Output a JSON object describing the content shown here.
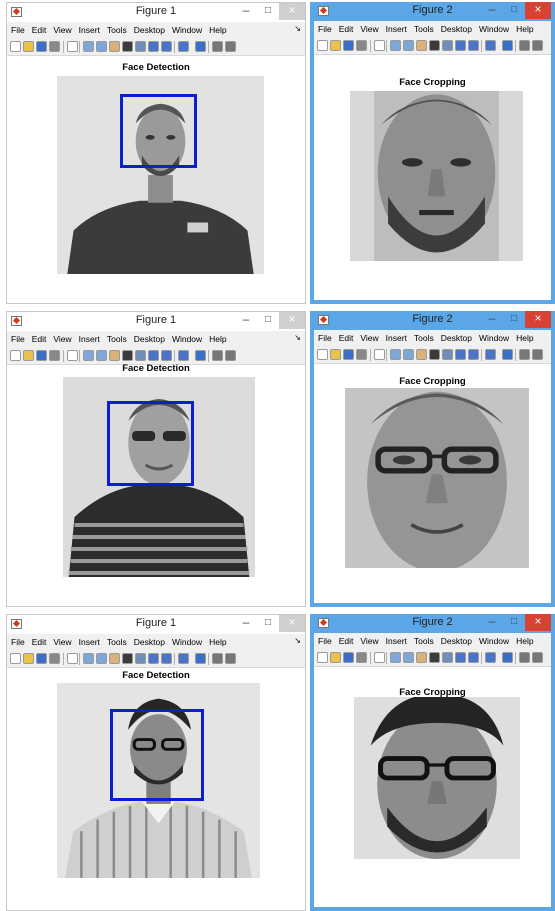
{
  "menu": [
    "File",
    "Edit",
    "View",
    "Insert",
    "Tools",
    "Desktop",
    "Window",
    "Help"
  ],
  "window_controls": {
    "minimize": "–",
    "maximize": "□",
    "close": "×"
  },
  "rows": [
    {
      "left": {
        "title": "Figure 1",
        "axes_title": "Face Detection"
      },
      "right": {
        "title": "Figure 2",
        "axes_title": "Face Cropping"
      }
    },
    {
      "left": {
        "title": "Figure 1",
        "axes_title": "Face Detection"
      },
      "right": {
        "title": "Figure 2",
        "axes_title": "Face Cropping"
      }
    },
    {
      "left": {
        "title": "Figure 1",
        "axes_title": "Face Detection"
      },
      "right": {
        "title": "Figure 2",
        "axes_title": "Face Cropping"
      }
    }
  ],
  "colors": {
    "active_frame": "#5aa6e6",
    "bounding_box": "#0a1fd0",
    "close_button": "#d94132"
  },
  "icons": [
    "new-figure-icon",
    "open-icon",
    "save-icon",
    "print-icon",
    "pointer-icon",
    "zoom-in-icon",
    "zoom-out-icon",
    "pan-icon",
    "rotate-icon",
    "data-cursor-icon",
    "brush-icon",
    "link-icon",
    "colorbar-icon",
    "legend-icon",
    "hide-plot-tools-icon",
    "show-plot-tools-icon"
  ]
}
